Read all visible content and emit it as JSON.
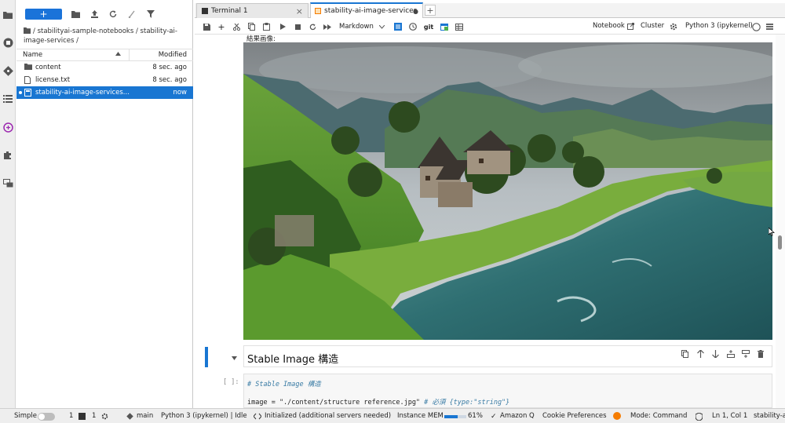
{
  "file_browser": {
    "new_label": "+",
    "breadcrumb": "/ stabilityai-sample-notebooks / stability-ai-image-services /",
    "columns": {
      "name": "Name",
      "modified": "Modified"
    },
    "items": [
      {
        "name": "content",
        "modified": "8 sec. ago",
        "icon": "folder-icon"
      },
      {
        "name": "license.txt",
        "modified": "8 sec. ago",
        "icon": "file-icon"
      },
      {
        "name": "stability-ai-image-services...",
        "modified": "now",
        "icon": "notebook-icon"
      }
    ]
  },
  "tabs": [
    {
      "label": "Terminal 1",
      "close": "×"
    },
    {
      "label": "stability-ai-image-services",
      "close": "●"
    }
  ],
  "notebook_toolbar": {
    "cell_type": "Markdown",
    "git_label": "git",
    "notebook_link": "Notebook",
    "cluster": "Cluster",
    "kernel": "Python 3 (ipykernel)"
  },
  "output_label": "結果画像:",
  "markdown_heading": "Stable Image 構造",
  "code_cell": {
    "prompt": "[ ]:",
    "line1": "# Stable Image 構造",
    "line2_code": "image = \"./content/structure reference.jpg\"",
    "line2_comment": "  # 必須 {type:\"string\"}"
  },
  "statusbar": {
    "mode_label": "Simple",
    "count1": "1",
    "count2": "1",
    "branch": "main",
    "kernel_status": "Python 3 (ipykernel) | Idle",
    "lsp": "Initialized (additional servers needed)",
    "mem_label": "Instance MEM",
    "mem_percent": "61%",
    "mem_fraction": 0.61,
    "amazon_q": "Amazon Q",
    "cookie": "Cookie Preferences",
    "mode": "Mode: Command",
    "cursor": "Ln 1, Col 1",
    "filename": "stability-a"
  },
  "colors": {
    "accent": "#1976d2",
    "new_button": "#1a73d9"
  }
}
